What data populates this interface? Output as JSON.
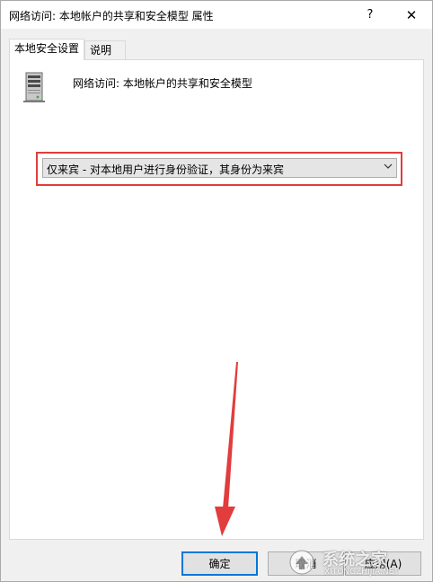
{
  "window": {
    "title": "网络访问: 本地帐户的共享和安全模型 属性",
    "help_label": "?",
    "close_label": "✕"
  },
  "tabs": [
    {
      "label": "本地安全设置",
      "active": true
    },
    {
      "label": "说明",
      "active": false
    }
  ],
  "panel": {
    "icon": "server-icon",
    "policy_name": "网络访问: 本地帐户的共享和安全模型",
    "dropdown_selected": "仅来宾 - 对本地用户进行身份验证，其身份为来宾"
  },
  "buttons": {
    "ok": "确定",
    "cancel": "取消",
    "apply": "应用(A)"
  },
  "annotations": {
    "highlight_color": "#e23c3c",
    "arrow_color": "#e23c3c"
  },
  "watermark": {
    "name": "系统之家",
    "url": "XITONGZHIJIA.NET"
  }
}
